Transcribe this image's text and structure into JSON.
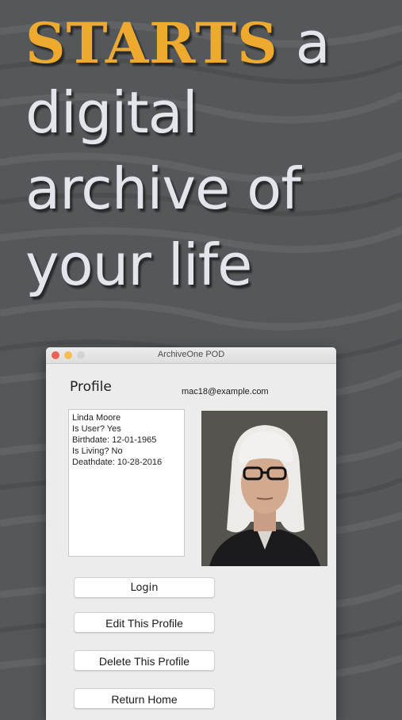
{
  "headline": {
    "highlight": "STARTS",
    "line1_rest": " a",
    "line2": "digital",
    "line3": "archive of",
    "line4": "your life"
  },
  "colors": {
    "background": "#55585b",
    "highlight": "#eeaa2f",
    "headline_text": "#e4e5ea"
  },
  "window": {
    "title": "ArchiveOne POD",
    "profile_heading": "Profile",
    "email": "mac18@example.com",
    "info_lines": [
      "Linda Moore",
      "Is User? Yes",
      "Birthdate: 12-01-1965",
      "Is Living? No",
      "Deathdate: 10-28-2016"
    ],
    "buttons": {
      "login": "Login",
      "edit": "Edit This Profile",
      "delete": "Delete This Profile",
      "return_home": "Return Home"
    }
  }
}
